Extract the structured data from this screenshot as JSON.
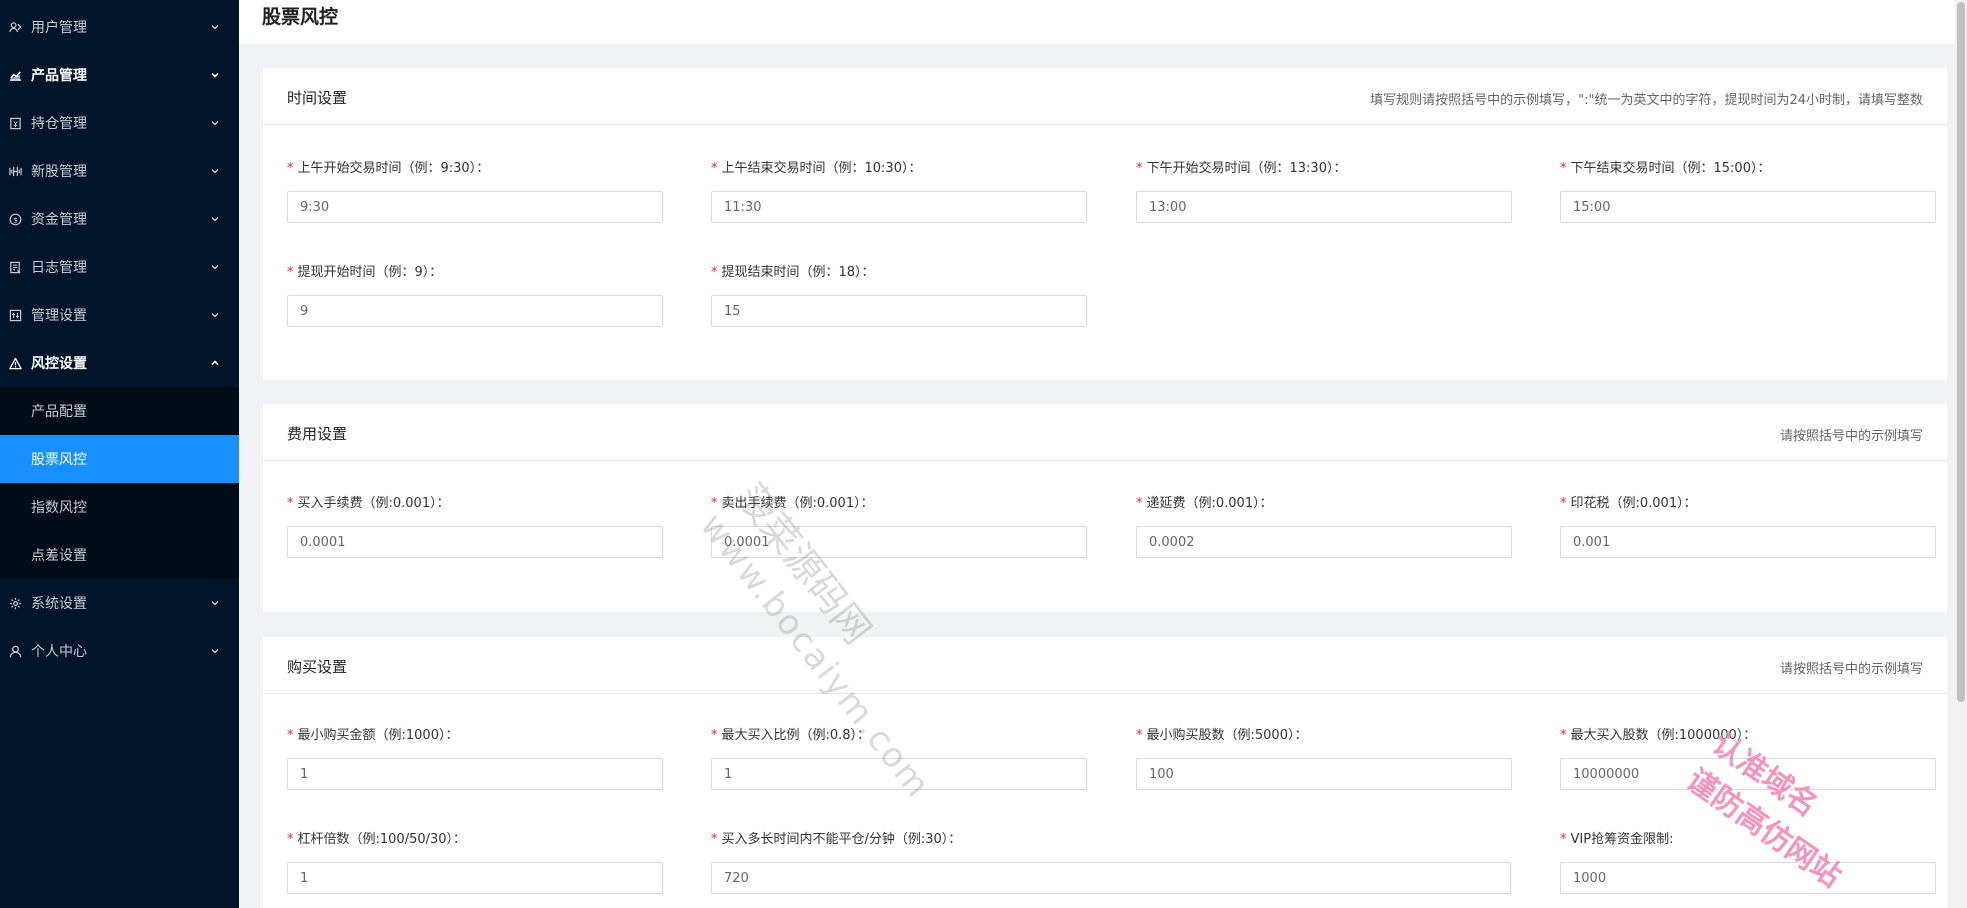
{
  "sidebar": {
    "items": [
      {
        "label": "用户管理",
        "icon": "users-icon",
        "top": 0
      },
      {
        "label": "产品管理",
        "icon": "line-chart-icon",
        "bold": true
      },
      {
        "label": "持仓管理",
        "icon": "wallet-icon"
      },
      {
        "label": "新股管理",
        "icon": "ipo-icon"
      },
      {
        "label": "资金管理",
        "icon": "dollar-icon"
      },
      {
        "label": "日志管理",
        "icon": "log-icon"
      },
      {
        "label": "管理设置",
        "icon": "settings-panel-icon"
      },
      {
        "label": "风控设置",
        "icon": "warning-icon",
        "bold": true,
        "expanded": true
      }
    ],
    "sub_items": [
      "产品配置",
      "股票风控",
      "指数风控",
      "点差设置"
    ],
    "after_items": [
      {
        "label": "系统设置",
        "icon": "gear-icon"
      },
      {
        "label": "个人中心",
        "icon": "user-icon"
      }
    ]
  },
  "page": {
    "title": "股票风控"
  },
  "time_card": {
    "title": "时间设置",
    "hint": "填写规则请按照括号中的示例填写，\":\"统一为英文中的字符，提现时间为24小时制，请填写整数",
    "fields": [
      {
        "label": "上午开始交易时间（例：9:30）：",
        "value": "9:30"
      },
      {
        "label": "上午结束交易时间（例：10:30）：",
        "value": "11:30"
      },
      {
        "label": "下午开始交易时间（例：13:30）：",
        "value": "13:00"
      },
      {
        "label": "下午结束交易时间（例：15:00）：",
        "value": "15:00"
      },
      {
        "label": "提现开始时间（例：9）：",
        "value": "9"
      },
      {
        "label": "提现结束时间（例：18）：",
        "value": "15"
      }
    ]
  },
  "fee_card": {
    "title": "费用设置",
    "hint": "请按照括号中的示例填写",
    "fields": [
      {
        "label": "买入手续费（例:0.001）：",
        "value": "0.0001"
      },
      {
        "label": "卖出手续费（例:0.001）：",
        "value": "0.0001"
      },
      {
        "label": "递延费（例:0.001）：",
        "value": "0.0002"
      },
      {
        "label": "印花税（例:0.001）：",
        "value": "0.001"
      }
    ]
  },
  "buy_card": {
    "title": "购买设置",
    "hint": "请按照括号中的示例填写",
    "fields": [
      {
        "label": "最小购买金额（例:1000）：",
        "value": "1"
      },
      {
        "label": "最大买入比例（例:0.8）：",
        "value": "1"
      },
      {
        "label": "最小购买股数（例:5000）：",
        "value": "100"
      },
      {
        "label": "最大买入股数（例:1000000）：",
        "value": "10000000"
      },
      {
        "label": "杠杆倍数（例:100/50/30）：",
        "value": "1"
      },
      {
        "label": "买入多长时间内不能平仓/分钟（例:30）：",
        "value": "720"
      },
      {
        "label": "VIP抢筹资金限制:",
        "value": "1000"
      }
    ]
  },
  "watermark": {
    "text1": "菠菜源码网",
    "url": "www.bocaiym.com",
    "text2_line1": "认准域名",
    "text2_line2": "谨防高仿网站"
  }
}
